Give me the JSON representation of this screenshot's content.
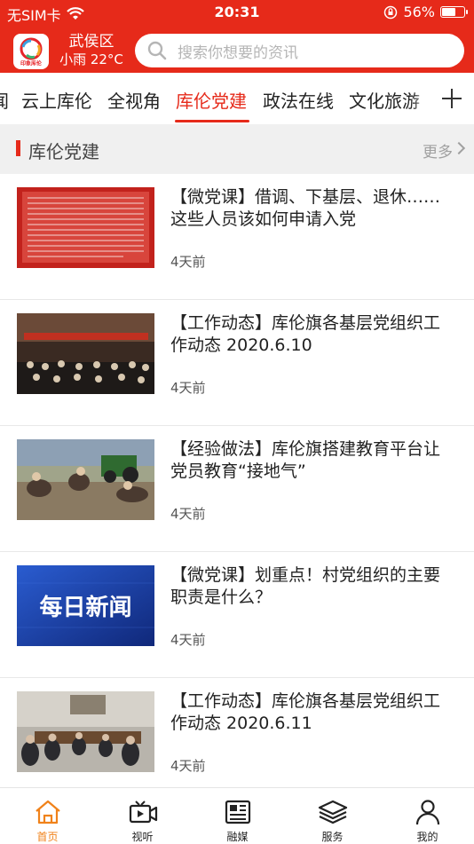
{
  "status_bar": {
    "carrier": "无SIM卡",
    "time": "20:31",
    "battery": "56%"
  },
  "header": {
    "district": "武侯区",
    "weather": "小雨 22°C",
    "search_placeholder": "搜索你想要的资讯",
    "logo_text": "印象库伦"
  },
  "tabs": [
    {
      "label": "闻"
    },
    {
      "label": "云上库伦"
    },
    {
      "label": "全视角"
    },
    {
      "label": "库伦党建",
      "active": true
    },
    {
      "label": "政法在线"
    },
    {
      "label": "文化旅游"
    }
  ],
  "section": {
    "title": "库伦党建",
    "more": "更多"
  },
  "news": [
    {
      "title": "【微党课】借调、下基层、退休……这些人员该如何申请入党",
      "time": "4天前"
    },
    {
      "title": "【工作动态】库伦旗各基层党组织工作动态 2020.6.10",
      "time": "4天前"
    },
    {
      "title": "【经验做法】库伦旗搭建教育平台让党员教育“接地气”",
      "time": "4天前"
    },
    {
      "title": "【微党课】划重点！村党组织的主要职责是什么？",
      "time": "4天前",
      "thumb_text": "每日新闻"
    },
    {
      "title": "【工作动态】库伦旗各基层党组织工作动态 2020.6.11",
      "time": "4天前"
    }
  ],
  "tabbar": [
    {
      "label": "首页",
      "active": true
    },
    {
      "label": "视听"
    },
    {
      "label": "融媒"
    },
    {
      "label": "服务"
    },
    {
      "label": "我的"
    }
  ],
  "colors": {
    "brand_red": "#e62a1a",
    "active_tab_orange": "#f0821a"
  }
}
